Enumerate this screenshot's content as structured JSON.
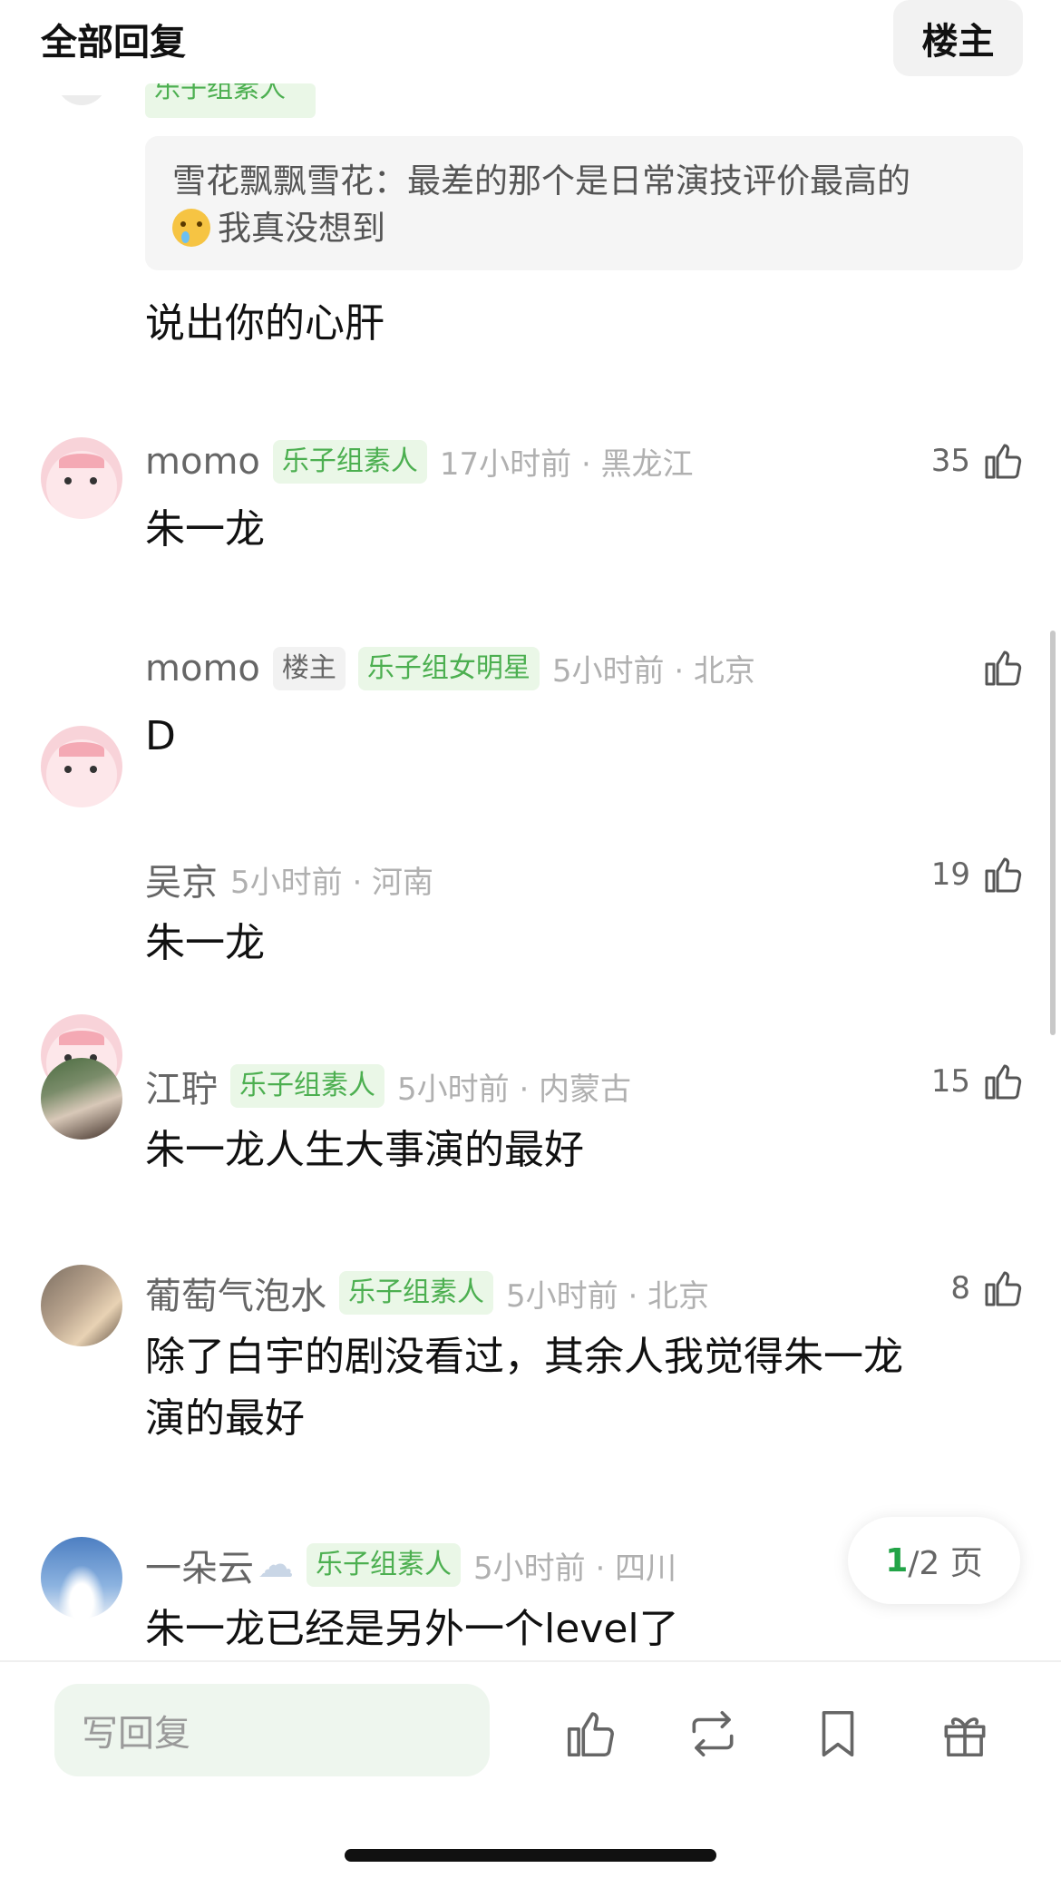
{
  "header": {
    "title": "全部回复",
    "owner_button": "楼主"
  },
  "partial_badge": "乐子组素人",
  "quote": {
    "author": "雪花飘飘雪花：",
    "text_line1": "最差的那个是日常演技评价最高的",
    "text_line2": "我真没想到",
    "emoji": "crying-face-emoji"
  },
  "reply_body": "说出你的心肝",
  "comments": [
    {
      "name": "momo",
      "badges": [
        "乐子组素人"
      ],
      "time": "17小时前 · 黑龙江",
      "likes": "35",
      "body": "朱一龙",
      "avatar": "pink-cartoon-avatar"
    },
    {
      "name": "momo",
      "badges": [
        "楼主",
        "乐子组女明星"
      ],
      "time": "5小时前 · 北京",
      "likes": "",
      "body": "D",
      "avatar": "pink-cartoon-avatar"
    },
    {
      "name": "吴京",
      "badges": [],
      "time": "5小时前 · 河南",
      "likes": "19",
      "body": "朱一龙",
      "avatar": "pink-cartoon-avatar"
    },
    {
      "name": "江聍",
      "badges": [
        "乐子组素人"
      ],
      "time": "5小时前 · 内蒙古",
      "likes": "15",
      "body": "朱一龙人生大事演的最好",
      "avatar": "photo-girl-avatar"
    },
    {
      "name": "葡萄气泡水",
      "badges": [
        "乐子组素人"
      ],
      "time": "5小时前 · 北京",
      "likes": "8",
      "body_line1": "除了白宇的剧没看过，其余人我觉得朱一龙",
      "body_line2": "演的最好",
      "avatar": "photo-dog-avatar"
    },
    {
      "name": "一朵云",
      "name_emoji": "☁",
      "badges": [
        "乐子组素人"
      ],
      "time": "5小时前 · 四川",
      "body": "朱一龙已经是另外一个level了",
      "avatar": "sky-cloud-avatar"
    }
  ],
  "pager": {
    "current": "1",
    "rest": "/2 页"
  },
  "bottom_bar": {
    "reply_placeholder": "写回复"
  },
  "colors": {
    "accent_green": "#4caf50",
    "badge_bg": "#eaf7e7",
    "pager_current": "#22a447"
  }
}
